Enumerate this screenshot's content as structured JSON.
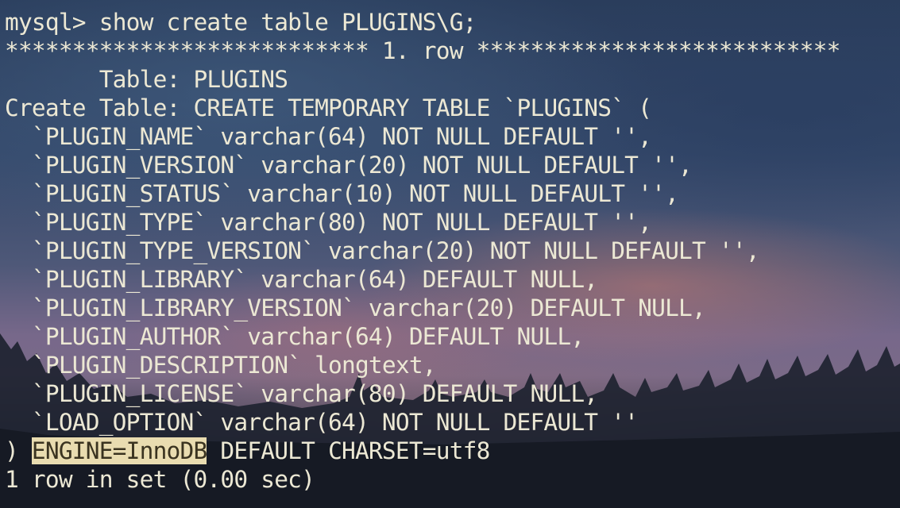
{
  "terminal": {
    "prompt": "mysql> ",
    "command": "show create table PLUGINS\\G;",
    "row_header": "*************************** 1. row ***************************",
    "table_label": "       Table: ",
    "table_name": "PLUGINS",
    "create_label": "Create Table: ",
    "create_statement": "CREATE TEMPORARY TABLE `PLUGINS` (",
    "columns": [
      "  `PLUGIN_NAME` varchar(64) NOT NULL DEFAULT '',",
      "  `PLUGIN_VERSION` varchar(20) NOT NULL DEFAULT '',",
      "  `PLUGIN_STATUS` varchar(10) NOT NULL DEFAULT '',",
      "  `PLUGIN_TYPE` varchar(80) NOT NULL DEFAULT '',",
      "  `PLUGIN_TYPE_VERSION` varchar(20) NOT NULL DEFAULT '',",
      "  `PLUGIN_LIBRARY` varchar(64) DEFAULT NULL,",
      "  `PLUGIN_LIBRARY_VERSION` varchar(20) DEFAULT NULL,",
      "  `PLUGIN_AUTHOR` varchar(64) DEFAULT NULL,",
      "  `PLUGIN_DESCRIPTION` longtext,",
      "  `PLUGIN_LICENSE` varchar(80) DEFAULT NULL,",
      "  `LOAD_OPTION` varchar(64) NOT NULL DEFAULT ''"
    ],
    "closing_paren": ") ",
    "engine_selected": "ENGINE=InnoDB",
    "charset_rest": " DEFAULT CHARSET=utf8",
    "result_summary": "1 row in set (0.00 sec)"
  },
  "colors": {
    "text": "#ece8d4",
    "selection_bg": "#e9dcb0",
    "selection_text": "#3a3320"
  }
}
